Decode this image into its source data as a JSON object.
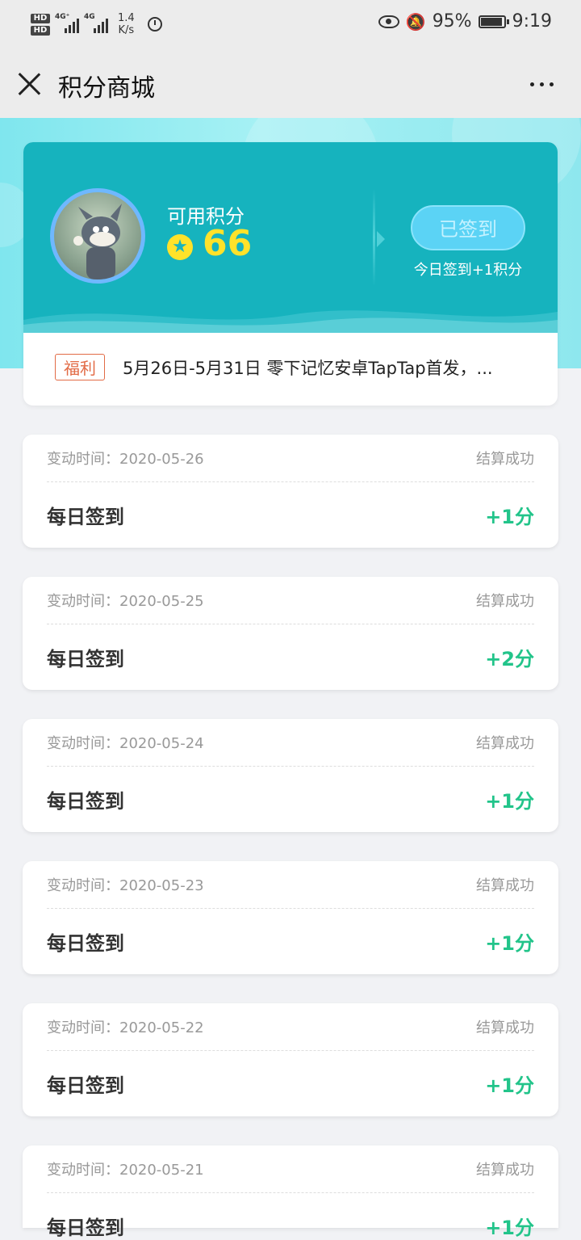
{
  "status_bar": {
    "hd1": "HD",
    "hd2": "HD",
    "net1": "4G⁺",
    "net2": "4G",
    "speed_value": "1.4",
    "speed_unit": "K/s",
    "battery_pct": "95%",
    "battery_level": 0.95,
    "time": "9:19"
  },
  "nav": {
    "title": "积分商城"
  },
  "points": {
    "label": "可用积分",
    "value": "66",
    "signed_button": "已签到",
    "sign_hint": "今日签到+1积分"
  },
  "notice": {
    "tag": "福利",
    "text": "5月26日-5月31日 零下记忆安卓TapTap首发，..."
  },
  "records": [
    {
      "time": "变动时间：2020-05-26",
      "status": "结算成功",
      "title": "每日签到",
      "delta": "+1分"
    },
    {
      "time": "变动时间：2020-05-25",
      "status": "结算成功",
      "title": "每日签到",
      "delta": "+2分"
    },
    {
      "time": "变动时间：2020-05-24",
      "status": "结算成功",
      "title": "每日签到",
      "delta": "+1分"
    },
    {
      "time": "变动时间：2020-05-23",
      "status": "结算成功",
      "title": "每日签到",
      "delta": "+1分"
    },
    {
      "time": "变动时间：2020-05-22",
      "status": "结算成功",
      "title": "每日签到",
      "delta": "+1分"
    },
    {
      "time": "变动时间：2020-05-21",
      "status": "结算成功",
      "title": "每日签到",
      "delta": "+1分"
    }
  ],
  "colors": {
    "accent": "#16b3be",
    "points_yellow": "#ffe22a",
    "delta_green": "#22c48a",
    "tag_orange": "#e26b46"
  }
}
